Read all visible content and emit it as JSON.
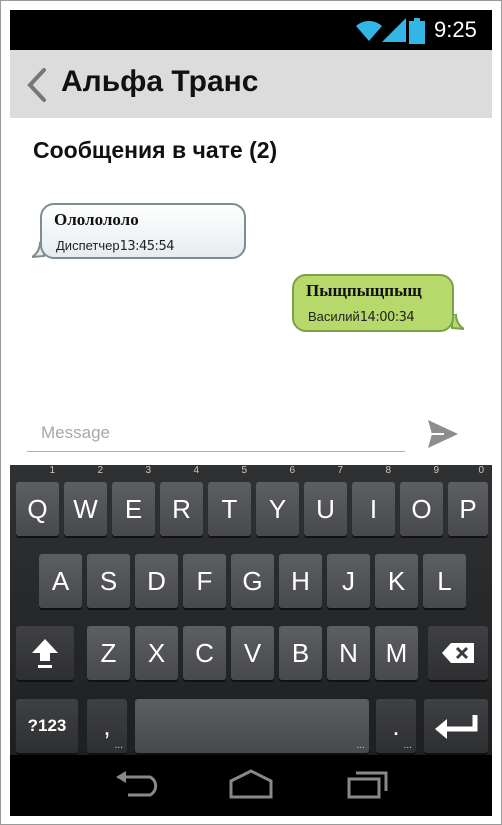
{
  "status": {
    "time": "9:25"
  },
  "appbar": {
    "title": "Альфа Транс"
  },
  "chat": {
    "title": "Сообщения в чате (2)",
    "messages": [
      {
        "text": "Ололололо",
        "sender": "Диспетчер",
        "time": "13:45:54",
        "direction": "incoming"
      },
      {
        "text": "Пыщпыщпыщ",
        "sender": "Василий",
        "time": "14:00:34",
        "direction": "outgoing"
      }
    ]
  },
  "input": {
    "placeholder": "Message"
  },
  "keyboard": {
    "row1": [
      {
        "label": "Q",
        "hint": "1"
      },
      {
        "label": "W",
        "hint": "2"
      },
      {
        "label": "E",
        "hint": "3"
      },
      {
        "label": "R",
        "hint": "4"
      },
      {
        "label": "T",
        "hint": "5"
      },
      {
        "label": "Y",
        "hint": "6"
      },
      {
        "label": "U",
        "hint": "7"
      },
      {
        "label": "I",
        "hint": "8"
      },
      {
        "label": "O",
        "hint": "9"
      },
      {
        "label": "P",
        "hint": "0"
      }
    ],
    "row2": [
      "A",
      "S",
      "D",
      "F",
      "G",
      "H",
      "J",
      "K",
      "L"
    ],
    "row3": [
      "Z",
      "X",
      "C",
      "V",
      "B",
      "N",
      "M"
    ],
    "symbols_label": "?123",
    "comma_label": ",",
    "period_label": ".",
    "icons": {
      "shift": "shift-icon",
      "backspace": "backspace-icon",
      "enter": "enter-icon"
    }
  },
  "nav": {
    "icons": [
      "back-icon",
      "home-icon",
      "recent-apps-icon"
    ]
  },
  "colors": {
    "outgoing_bubble": "#b7d86a",
    "incoming_bubble": "#eef2f4",
    "appbar": "#dcdcdc",
    "keyboard": "#2a2b2d"
  }
}
